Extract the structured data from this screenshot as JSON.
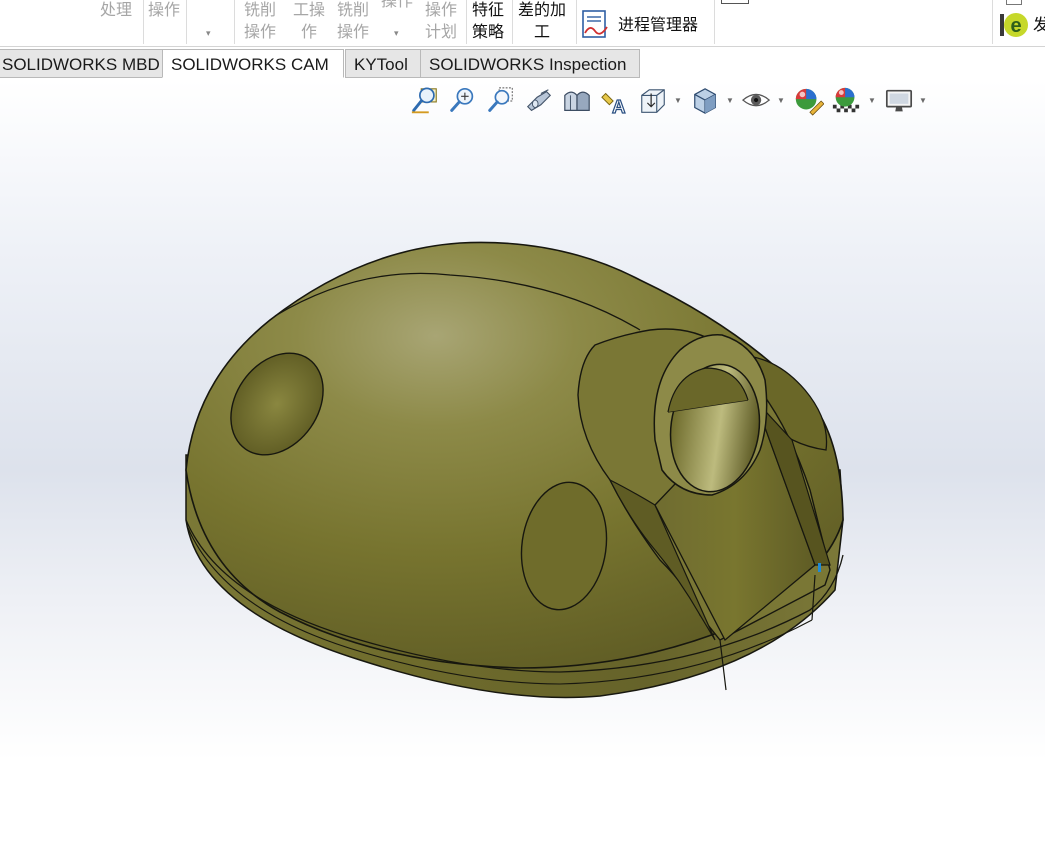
{
  "ribbon": {
    "items": [
      {
        "id": "process",
        "label": "处理"
      },
      {
        "id": "operation",
        "label": "操作"
      },
      {
        "id": "mill-operation",
        "line1": "铣削",
        "line2": "操作"
      },
      {
        "id": "turn-operation",
        "line1": "工操",
        "line2": "作"
      },
      {
        "id": "mill-operation-2",
        "line1": "铣削",
        "line2": "操作"
      },
      {
        "id": "operation-top",
        "label": "操作"
      },
      {
        "id": "operation-plan",
        "line1": "操作",
        "line2": "计划"
      },
      {
        "id": "feature-strategy",
        "line1": "特征",
        "line2": "策略"
      },
      {
        "id": "difference-machining",
        "line1": "差的加",
        "line2": "工"
      },
      {
        "id": "process-manager",
        "label": "进程管理器"
      },
      {
        "id": "publish",
        "label": "发"
      }
    ],
    "dropdown_arrow": "▾"
  },
  "tabs": [
    {
      "label": "SOLIDWORKS MBD",
      "active": false
    },
    {
      "label": "SOLIDWORKS CAM",
      "active": true
    },
    {
      "label": "KYTool",
      "active": false
    },
    {
      "label": "SOLIDWORKS Inspection",
      "active": false
    }
  ],
  "view_toolbar": {
    "icons": [
      "zoom-to-fit-icon",
      "zoom-to-area-icon",
      "previous-view-icon",
      "section-view-icon",
      "dynamic-annotation-views-icon",
      "view-orientation-icon",
      "display-style-icon",
      "hide-show-items-icon",
      "edit-appearance-icon",
      "apply-scene-icon",
      "view-settings-icon"
    ]
  },
  "model": {
    "part_color": "#7c7a3c",
    "edge_color": "#1a1a12"
  }
}
